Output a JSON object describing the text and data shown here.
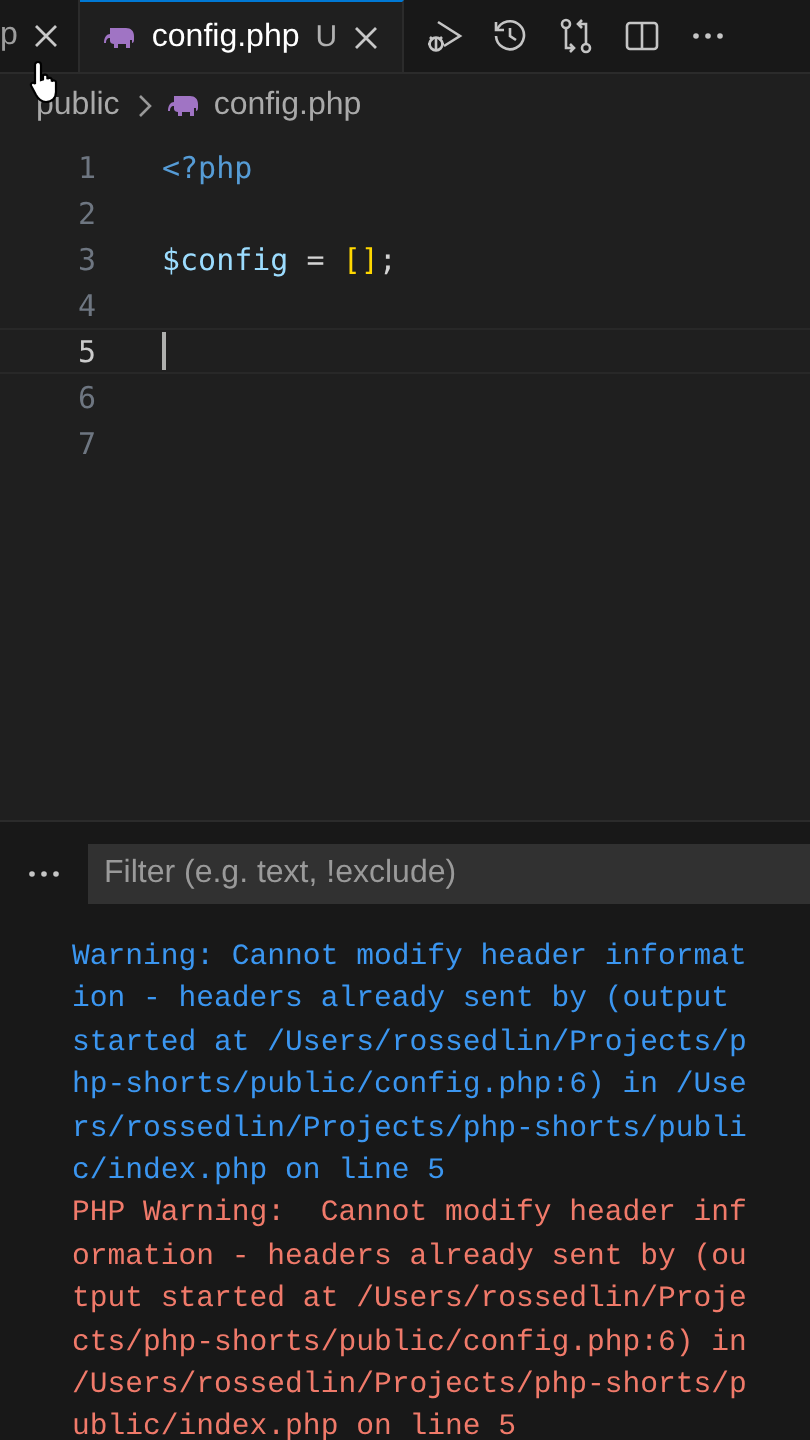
{
  "tabs": [
    {
      "label": "p",
      "selected": false
    },
    {
      "label": "config.php",
      "selected": true,
      "status": "U"
    }
  ],
  "breadcrumbs": [
    "public",
    "config.php"
  ],
  "editor": {
    "lines": [
      {
        "number": "1",
        "current": false,
        "tokens": [
          {
            "kind": "tag",
            "text": "<?php"
          }
        ]
      },
      {
        "number": "2",
        "current": false
      },
      {
        "number": "3",
        "current": false,
        "tokens": [
          {
            "kind": "var",
            "text": "$config"
          },
          {
            "kind": "plain",
            "text": " = "
          },
          {
            "kind": "bracket",
            "text": "[]"
          },
          {
            "kind": "plain",
            "text": ";"
          }
        ]
      },
      {
        "number": "4",
        "current": false
      },
      {
        "number": "5",
        "current": true
      },
      {
        "number": "6",
        "current": false
      },
      {
        "number": "7",
        "current": false
      }
    ]
  },
  "panel": {
    "filter": {
      "placeholder": "Filter (e.g. text, !exclude)"
    },
    "output": [
      {
        "kind": "info",
        "text": "Warning: Cannot modify header information - headers already sent by (output started at /Users/rossedlin/Projects/php-shorts/public/config.php:6) in /Users/rossedlin/Projects/php-shorts/public/index.php on line 5"
      },
      {
        "kind": "error",
        "text": "PHP Warning:  Cannot modify header information - headers already sent by (output started at /Users/rossedlin/Projects/php-shorts/public/config.php:6) in /Users/rossedlin/Projects/php-shorts/public/index.php on line 5"
      }
    ]
  }
}
